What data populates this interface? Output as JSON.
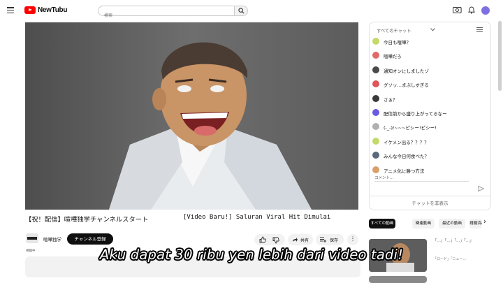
{
  "app": {
    "logo_text": "NewTubu"
  },
  "search": {
    "placeholder": "検索"
  },
  "video": {
    "title_jp": "【祝！配信】喧嘩独学チャンネルスタート",
    "title_id": "[Video Baru!] Saluran Viral Hit Dimulai",
    "channel_name": "喧嘩独学",
    "subscribe_label": "チャンネル登録",
    "share_label": "共有",
    "save_label": "保存",
    "more_label": "⋮",
    "meta_text": "視聴中"
  },
  "chat": {
    "header_label": "すべてのチャット",
    "messages": [
      {
        "text": "今日も喧嘩？",
        "avatar_color": "#c3d96a"
      },
      {
        "text": "喧嘩だろ",
        "avatar_color": "#e06a6a"
      },
      {
        "text": "通知オンにしましたゾ",
        "avatar_color": "#4a4a4a"
      },
      {
        "text": "グソッ…まぶしすぎる",
        "avatar_color": "#e0555a"
      },
      {
        "text": "さぁ？",
        "avatar_color": "#3a3a3a"
      },
      {
        "text": "配信前から盛り上がってるなー",
        "avatar_color": "#6a5ae0"
      },
      {
        "text": "(-_-)/~~~ピシー!ピシー!",
        "avatar_color": "#b0b0b0"
      },
      {
        "text": "イケメン出る？？？？",
        "avatar_color": "#c3d96a"
      },
      {
        "text": "みんな今日何食べた？",
        "avatar_color": "#5a6a7a"
      },
      {
        "text": "アニメ化に勝つ方法",
        "avatar_color": "#d9a06a"
      }
    ],
    "input_placeholder": "コメント...",
    "hide_label": "チャットを非表示"
  },
  "chips": [
    {
      "label": "すべての動画"
    },
    {
      "label": "関連動画"
    },
    {
      "label": "最近の動画"
    },
    {
      "label": "視聴済み"
    }
  ],
  "recommended": {
    "title": "「…」「…」「…」「…」",
    "subtitle": "「ロード」「ニュー…"
  },
  "subtitle_overlay": "Aku dapat 30 ribu yen lebih dari video tadi!",
  "colors": {
    "accent": "#ff0000",
    "subscribe_bg": "#0f0f0f"
  }
}
